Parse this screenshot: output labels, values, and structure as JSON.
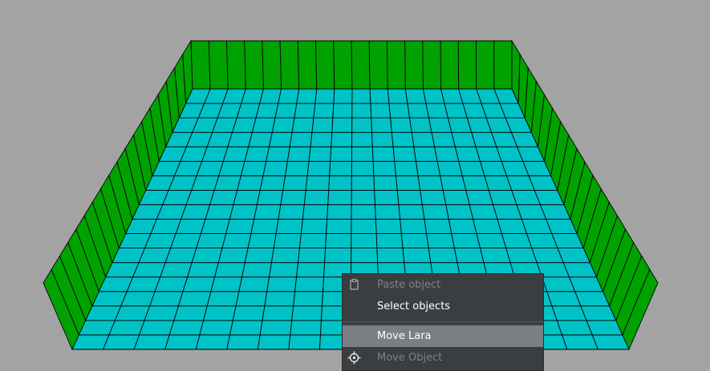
{
  "scene": {
    "floor_color": "#00c3c8",
    "wall_color": "#00a200",
    "grid_line_color": "#000000",
    "background_color": "#a3a3a3"
  },
  "context_menu": {
    "items": [
      {
        "label": "Paste object",
        "icon": "clipboard-icon",
        "enabled": false,
        "highlighted": false
      },
      {
        "label": "Select objects",
        "icon": "",
        "enabled": true,
        "highlighted": false
      },
      {
        "label": "Move Lara",
        "icon": "",
        "enabled": true,
        "highlighted": true
      },
      {
        "label": "Move Object",
        "icon": "crosshair-icon",
        "enabled": false,
        "highlighted": false
      }
    ]
  }
}
